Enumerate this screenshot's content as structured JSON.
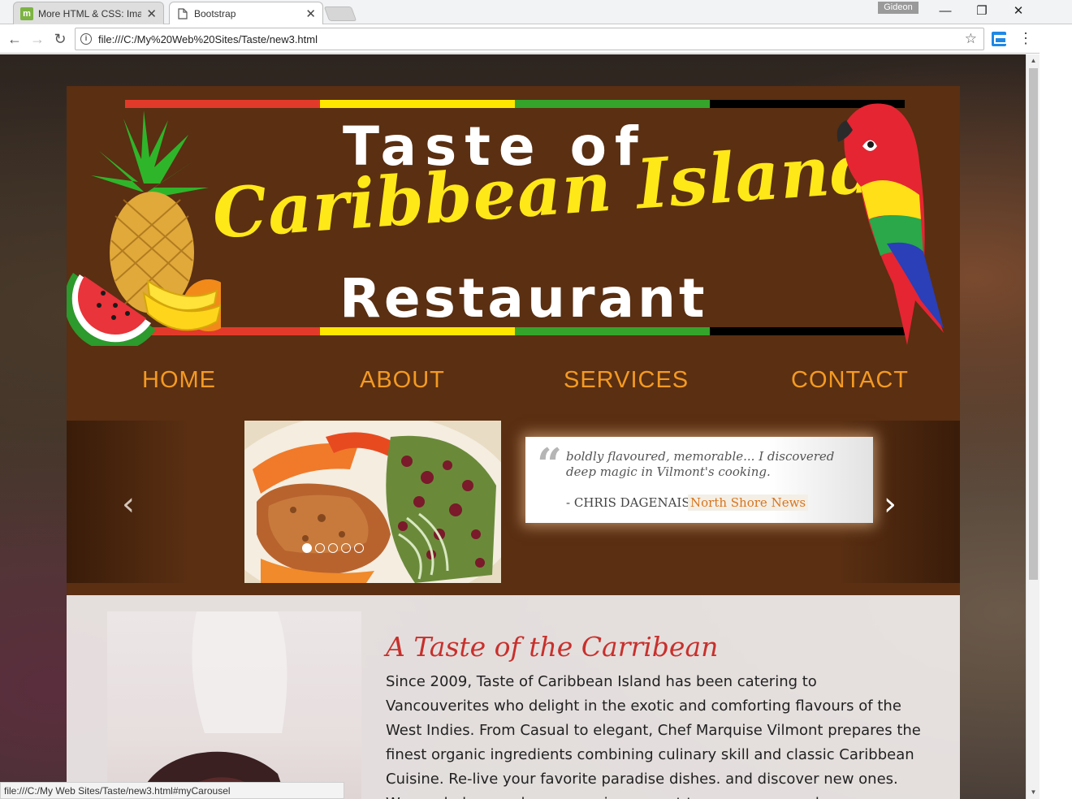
{
  "browser": {
    "tabs": [
      {
        "title": "More HTML & CSS: Imag",
        "favicon": "m"
      },
      {
        "title": "Bootstrap",
        "favicon": "page-icon"
      }
    ],
    "profile": "Gideon",
    "url": "file:///C:/My%20Web%20Sites/Taste/new3.html",
    "status_url": "file:///C:/My Web Sites/Taste/new3.html#myCarousel"
  },
  "logo": {
    "line1": "Taste of",
    "line2": "Caribbean Islands",
    "line3": "Restaurant",
    "stripe_colors": [
      "#e23a2a",
      "#ffe600",
      "#34a52a",
      "#000000"
    ]
  },
  "nav": {
    "items": [
      "HOME",
      "ABOUT",
      "SERVICES",
      "CONTACT"
    ],
    "color": "#f49a22"
  },
  "carousel": {
    "quote": "boldly flavoured, memorable... I discovered deep magic in Vilmont's cooking.",
    "author": "- CHRIS DAGENAIS",
    "source": "North Shore News",
    "slide_count": 5,
    "active_slide": 1,
    "prev_icon": "chevron-left-icon",
    "next_icon": "chevron-right-icon"
  },
  "content": {
    "title": "A Taste of the Carribean",
    "body": "Since 2009, Taste of Caribbean Island has been catering to Vancouverites who delight in the exotic and comforting flavours of the West Indies. From Casual to elegant, Chef Marquise Vilmont prepares the finest organic ingredients combining culinary skill and classic Caribbean Cuisine. Re-live your favorite paradise dishes. and discover new ones. We can help you plan your unique event to ensure you and"
  }
}
